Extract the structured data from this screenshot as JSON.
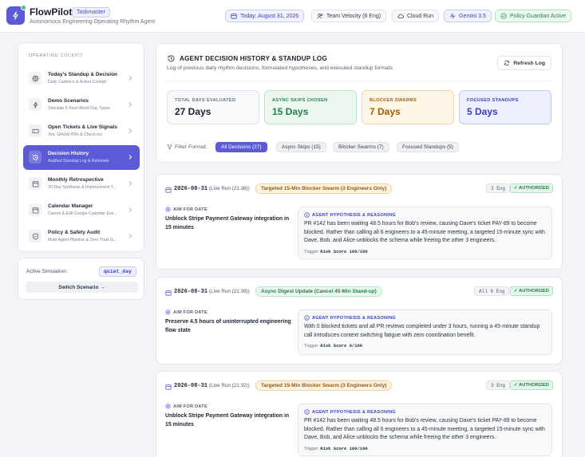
{
  "header": {
    "app_name": "FlowPilot",
    "app_badge": "Taskmaster",
    "app_subtitle": "Autonomous Engineering Operating Rhythm Agent",
    "pills": {
      "date": "Today: August 31, 2026",
      "team": "Team Velocity (6 Eng)",
      "run": "Cloud Run",
      "model": "Gemini 3.5",
      "policy": "Policy Guardian Active"
    }
  },
  "sidebar": {
    "title": "OPERATING COCKPIT",
    "items": [
      {
        "title": "Today's Standup & Decision",
        "subtitle": "Daily Cadence & Action Cockpit"
      },
      {
        "title": "Demo Scenarios",
        "subtitle": "Simulate 5 Real-World Day Types"
      },
      {
        "title": "Open Tickets & Live Signals",
        "subtitle": "Jira, GitHub PRs & Check-ins"
      },
      {
        "title": "Decision History",
        "subtitle": "Audited Standup Log & Rationale"
      },
      {
        "title": "Monthly Retrospective",
        "subtitle": "30-Day Synthesis & Improvement T..."
      },
      {
        "title": "Calendar Manager",
        "subtitle": "Cancel & Edit Google Calendar Eve..."
      },
      {
        "title": "Policy & Safety Audit",
        "subtitle": "Multi-Agent Pipeline & Zero-Trust G..."
      }
    ],
    "active_index": 3
  },
  "simulation": {
    "label": "Active Simulation:",
    "value": "quiet_day",
    "button": "Switch Scenario →"
  },
  "main": {
    "title": "AGENT DECISION HISTORY & STANDUP LOG",
    "subtitle": "Log of previous daily rhythm decisions, formulated hypotheses, and executed standup formats",
    "refresh_label": "Refresh Log",
    "stats": [
      {
        "label": "TOTAL DAYS EVALUATED",
        "value": "27 Days"
      },
      {
        "label": "ASYNC SKIPS CHOSEN",
        "value": "15 Days"
      },
      {
        "label": "BLOCKER SWARMS",
        "value": "7 Days"
      },
      {
        "label": "FOCUSED STANDUPS",
        "value": "5 Days"
      }
    ],
    "filter_label": "Filter Format:",
    "filters": [
      "All Decisions (27)",
      "Async Skips (15)",
      "Blocker Swarms (7)",
      "Focused Standups (5)"
    ],
    "active_filter": 0
  },
  "entries": [
    {
      "date": "2026-08-31",
      "run": "(Live Run (21:38))",
      "type": "Targeted 15-Min Blocker Swarm (3 Engineers Only)",
      "eng": "3 Eng",
      "status": "✓ AUTHORIZED",
      "aim_label": "AIM FOR DATE",
      "aim": "Unblock Stripe Payment Gateway integration in 15 minutes",
      "hyp_label": "AGENT HYPOTHESIS & REASONING",
      "hypothesis": "PR #142 has been waiting 48.5 hours for Bob's review, causing Dave's ticket PAY-89 to become blocked. Rather than calling all 6 engineers to a 45-minute meeting, a targeted 15-minute sync with Dave, Bob, and Alice unblocks the schema while freeing the other 3 engineers.",
      "trigger_label": "Trigger:",
      "trigger": "Risk Score 100/100"
    },
    {
      "date": "2026-08-31",
      "run": "(Live Run (21:39))",
      "type": "Async Digest Update (Cancel 45-Min Stand-up)",
      "eng": "All 6 Eng",
      "status": "✓ AUTHORIZED",
      "aim_label": "AIM FOR DATE",
      "aim": "Preserve 4.5 hours of uninterrupted engineering flow state",
      "hyp_label": "AGENT HYPOTHESIS & REASONING",
      "hypothesis": "With 0 blocked tickets and all PR reviews completed under 3 hours, running a 45-minute standup call introduces context switching fatigue with zero coordination benefit.",
      "trigger_label": "Trigger:",
      "trigger": "Risk Score 0/100"
    },
    {
      "date": "2026-08-31",
      "run": "(Live Run (21:32))",
      "type": "Targeted 15-Min Blocker Swarm (3 Engineers Only)",
      "eng": "3 Eng",
      "status": "✓ AUTHORIZED",
      "aim_label": "AIM FOR DATE",
      "aim": "Unblock Stripe Payment Gateway integration in 15 minutes",
      "hyp_label": "AGENT HYPOTHESIS & REASONING",
      "hypothesis": "PR #142 has been waiting 48.5 hours for Bob's review, causing Dave's ticket PAY-89 to become blocked. Rather than calling all 6 engineers to a 45-minute meeting, a targeted 15-minute sync with Dave, Bob, and Alice unblocks the schema while freeing the other 3 engineers.",
      "trigger_label": "Trigger:",
      "trigger": "Risk Score 100/100"
    }
  ]
}
